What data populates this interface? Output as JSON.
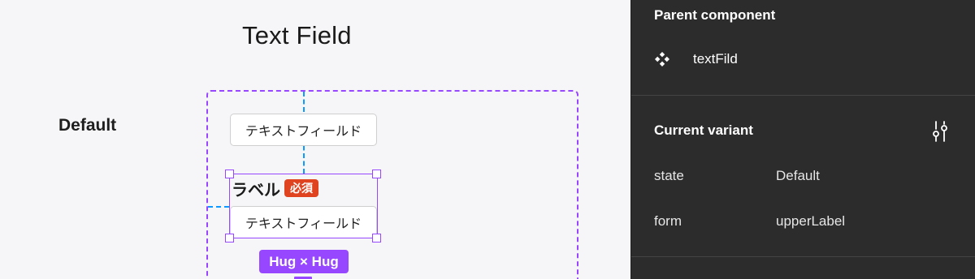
{
  "canvas": {
    "title": "Text Field",
    "row_label": "Default",
    "textfield_top": "テキストフィールド",
    "field_label": "ラベル",
    "required_badge": "必須",
    "textfield_bottom": "テキストフィールド",
    "size_badge": "Hug × Hug"
  },
  "panel": {
    "parent_component": {
      "title": "Parent component",
      "icon": "component-icon",
      "name": "textFild"
    },
    "current_variant": {
      "title": "Current variant",
      "icon": "adjust-sliders-icon",
      "properties": [
        {
          "key": "state",
          "value": "Default"
        },
        {
          "key": "form",
          "value": "upperLabel"
        }
      ]
    }
  },
  "colors": {
    "selection_purple": "#9747ff",
    "guide_blue": "#0d99ff",
    "required_red": "#e0431f",
    "panel_bg": "#2c2c2c"
  }
}
